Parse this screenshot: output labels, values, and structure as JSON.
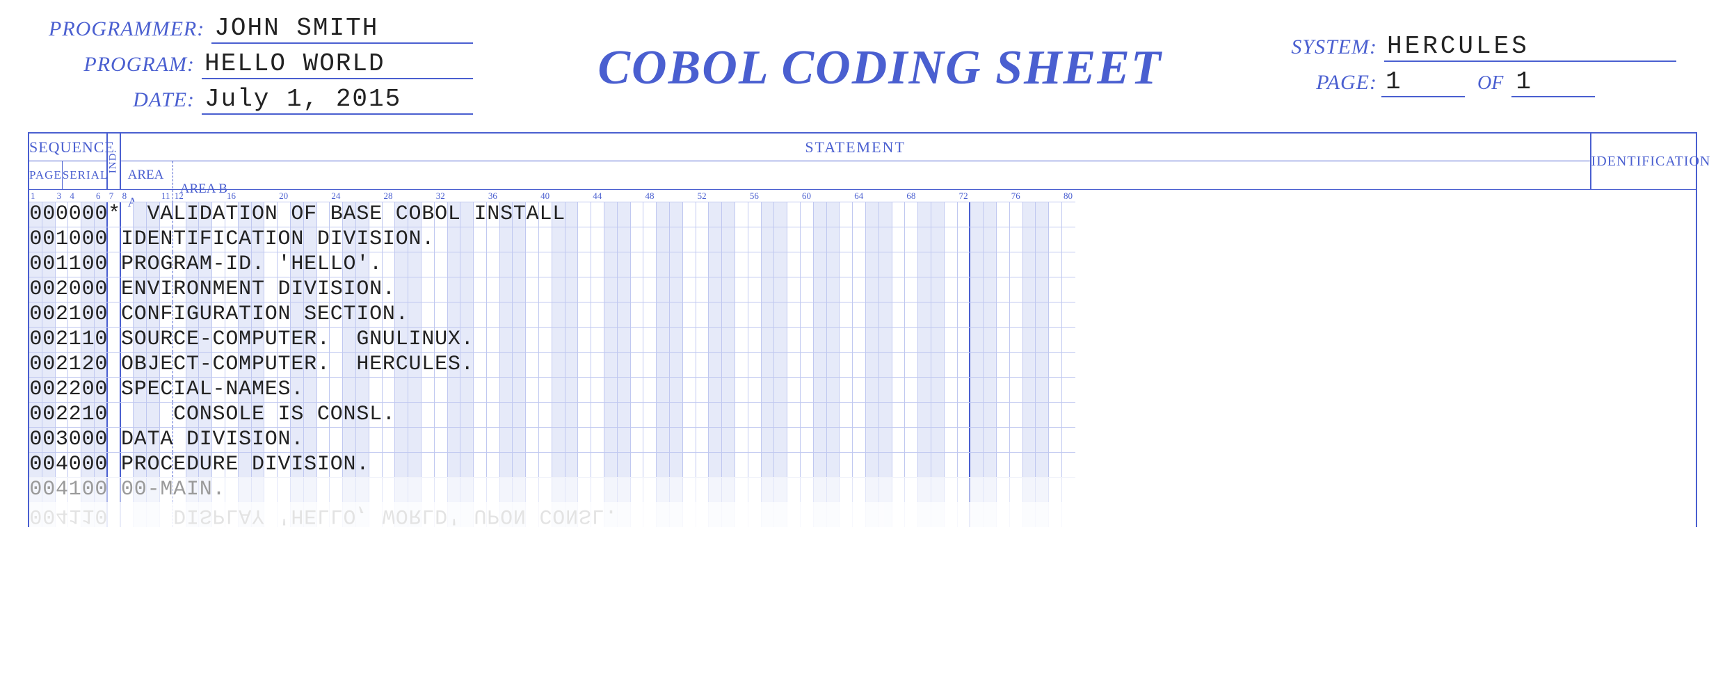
{
  "title": "COBOL CODING SHEET",
  "meta": {
    "programmer_label": "PROGRAMMER:",
    "programmer": "JOHN SMITH",
    "program_label": "PROGRAM:",
    "program": "HELLO WORLD",
    "date_label": "DATE:",
    "date": "July 1, 2015",
    "system_label": "SYSTEM:",
    "system": "HERCULES",
    "page_label": "PAGE:",
    "page": "1",
    "of_label": "OF",
    "of": "1"
  },
  "areas": {
    "sequence": "SEQUENCE",
    "page": "PAGE",
    "serial": "SERIAL",
    "ind": "IND.",
    "statement": "STATEMENT",
    "area_a": "AREA A",
    "area_b": "AREA B",
    "identification": "IDENTIFICATION"
  },
  "ruler": {
    "1": "1",
    "3": "3",
    "4": "4",
    "6": "6",
    "7": "7",
    "8": "8",
    "11": "11",
    "12": "12",
    "16": "16",
    "20": "20",
    "24": "24",
    "28": "28",
    "32": "32",
    "36": "36",
    "40": "40",
    "44": "44",
    "48": "48",
    "52": "52",
    "56": "56",
    "60": "60",
    "64": "64",
    "68": "68",
    "72": "72",
    "76": "76",
    "80": "80"
  },
  "code_lines": [
    "000000*  VALIDATION OF BASE COBOL INSTALL",
    "001000 IDENTIFICATION DIVISION.",
    "001100 PROGRAM-ID. 'HELLO'.",
    "002000 ENVIRONMENT DIVISION.",
    "002100 CONFIGURATION SECTION.",
    "002110 SOURCE-COMPUTER.  GNULINUX.",
    "002120 OBJECT-COMPUTER.  HERCULES.",
    "002200 SPECIAL-NAMES.",
    "002210     CONSOLE IS CONSL.",
    "003000 DATA DIVISION.",
    "004000 PROCEDURE DIVISION."
  ],
  "reflection_lines": [
    "004100 00-MAIN.",
    "004110     DISPLAY 'HELLO, WORLD' UPON CONSL."
  ],
  "columns": 80
}
